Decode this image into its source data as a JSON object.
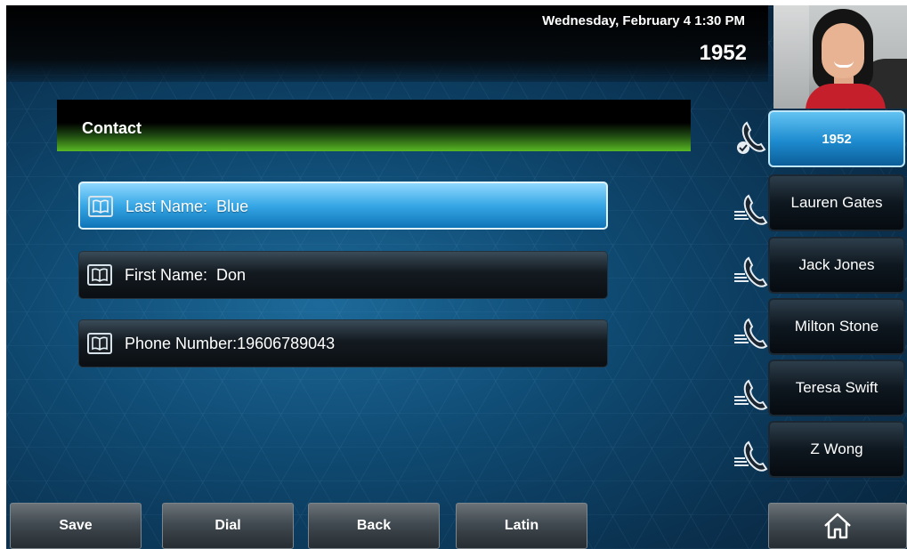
{
  "status_bar": {
    "datetime": "Wednesday, February 4  1:30 PM",
    "extension": "1952"
  },
  "contact_header": {
    "title": "Contact"
  },
  "fields": [
    {
      "label": "Last Name:",
      "value": "Blue",
      "icon": "directory-book-icon",
      "selected": true
    },
    {
      "label": "First Name:",
      "value": "Don",
      "icon": "directory-book-icon",
      "selected": false
    },
    {
      "label": "Phone Number:",
      "value": "19606789043",
      "icon": "directory-book-icon",
      "selected": false
    }
  ],
  "line_keys": [
    {
      "label": "1952",
      "icon": "registered-line-icon",
      "active": true
    },
    {
      "label": "Lauren Gates",
      "icon": "speed-dial-icon"
    },
    {
      "label": "Jack Jones",
      "icon": "speed-dial-icon"
    },
    {
      "label": "Milton Stone",
      "icon": "speed-dial-icon"
    },
    {
      "label": "Teresa Swift",
      "icon": "speed-dial-icon"
    },
    {
      "label": "Z Wong",
      "icon": "speed-dial-icon"
    }
  ],
  "softkeys": {
    "save": "Save",
    "dial": "Dial",
    "back": "Back",
    "latin": "Latin",
    "home_icon": "home-icon"
  },
  "colors": {
    "accent_blue": "#1d8bcf",
    "header_green": "#59b824",
    "background": "#0f4a72"
  }
}
